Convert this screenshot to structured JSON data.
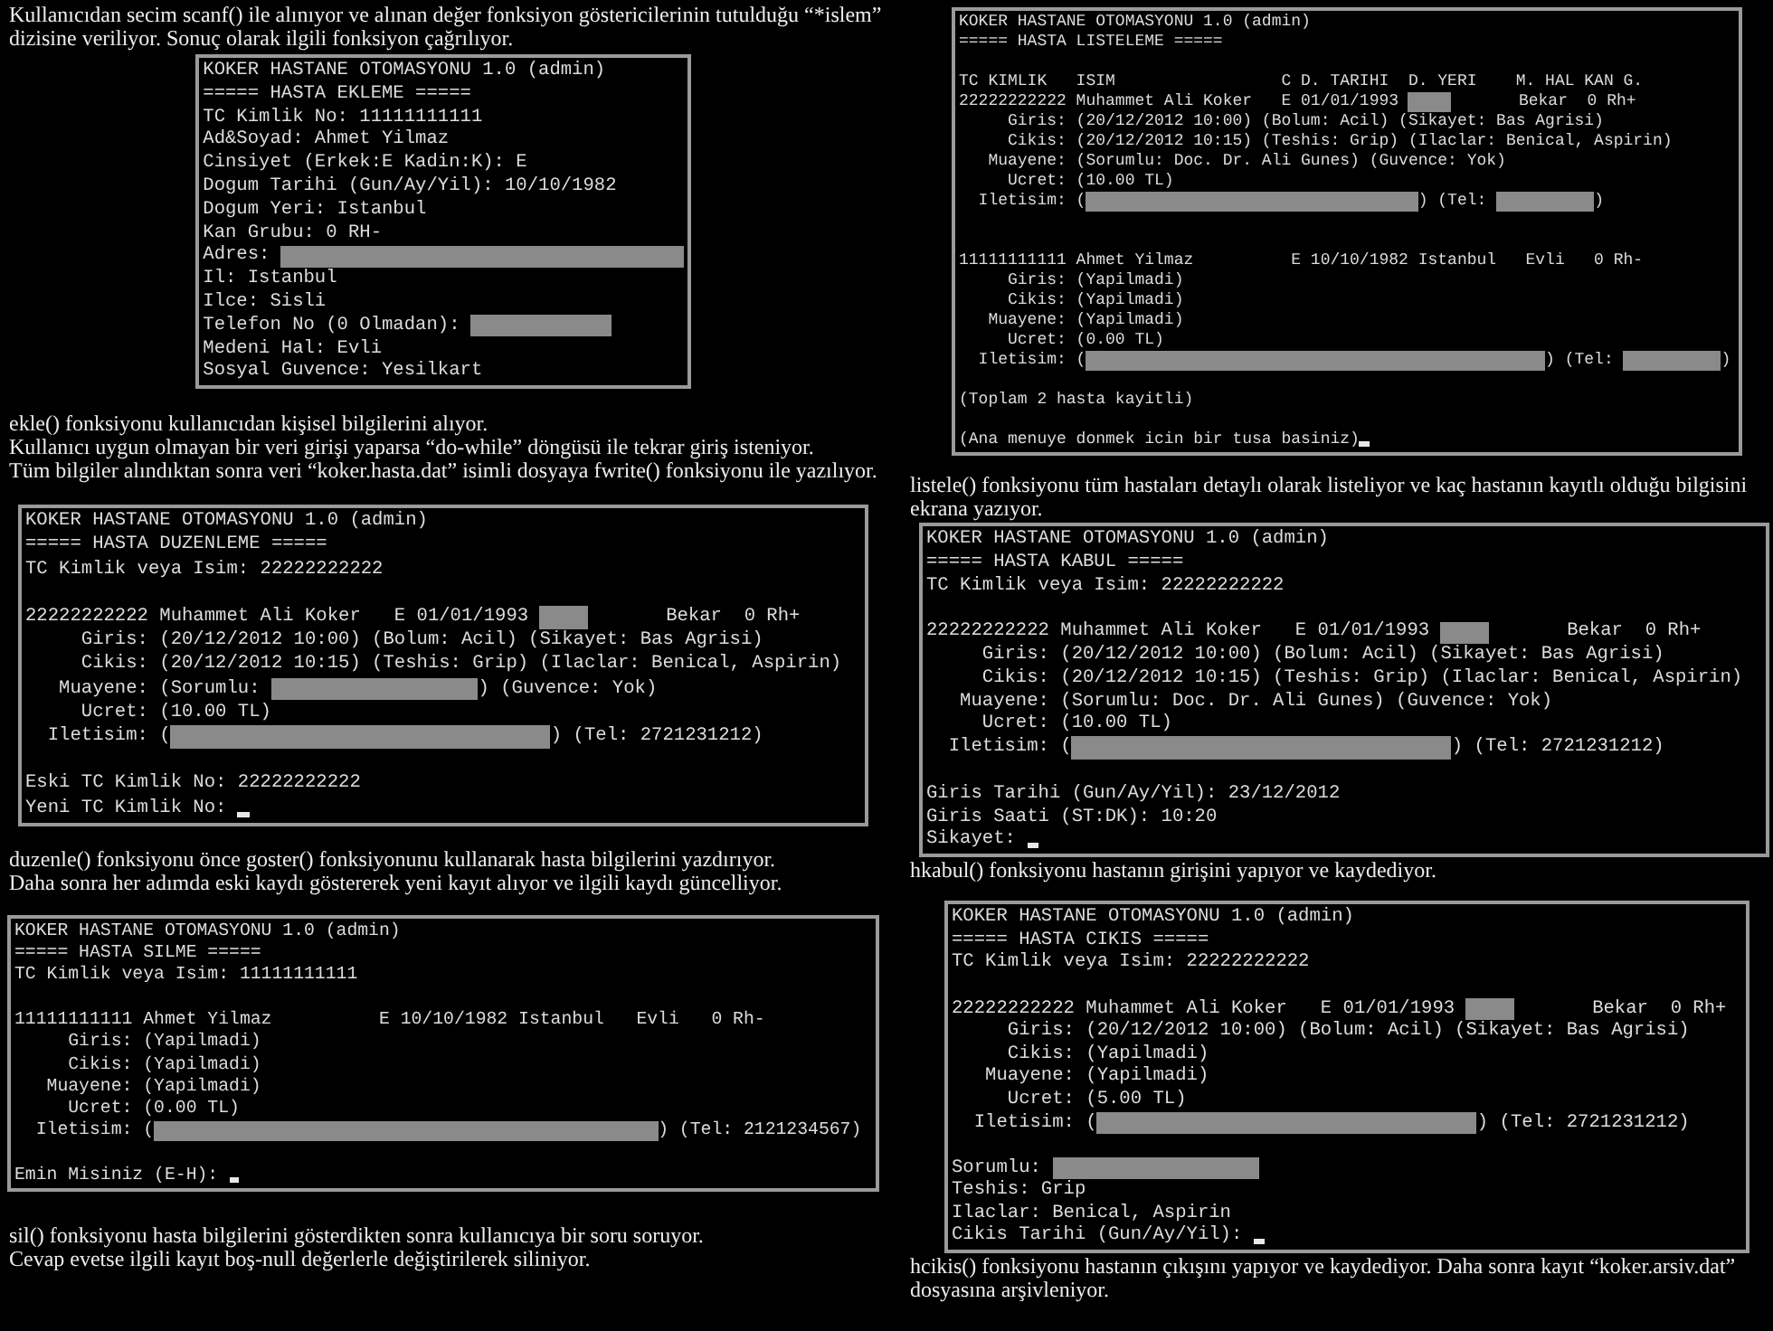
{
  "columns": [
    {
      "blocks": [
        {
          "kind": "caption",
          "lines": [
            "Kullanıcıdan secim scanf() ile alınıyor ve alınan değer fonksiyon göstericilerinin tutulduğu “*islem”",
            "dizisine veriliyor. Sonuç olarak ilgili fonksiyon çağrılıyor."
          ]
        },
        {
          "kind": "terminal",
          "lines": [
            {
              "parts": [
                "KOKER HASTANE OTOMASYONU 1.0 (admin)"
              ]
            },
            {
              "parts": [
                "===== HASTA EKLEME ====="
              ]
            },
            {
              "parts": [
                "TC Kimlik No: 11111111111"
              ]
            },
            {
              "parts": [
                "Ad&Soyad: Ahmet Yilmaz"
              ]
            },
            {
              "parts": [
                "Cinsiyet (Erkek:E Kadin:K): E"
              ]
            },
            {
              "parts": [
                "Dogum Tarihi (Gun/Ay/Yil): 10/10/1982"
              ]
            },
            {
              "parts": [
                "Dogum Yeri: Istanbul"
              ]
            },
            {
              "parts": [
                "Kan Grubu: 0 RH-"
              ]
            },
            {
              "parts": [
                "Adres: ",
                {
                  "kind": "longer_redaction"
                }
              ]
            },
            {
              "parts": [
                "Il: Istanbul"
              ]
            },
            {
              "parts": [
                "Ilce: Sisli"
              ]
            },
            {
              "parts": [
                "Telefon No (0 Olmadan): ",
                {
                  "kind": "medium_redaction"
                }
              ]
            },
            {
              "parts": [
                "Medeni Hal: Evli"
              ]
            },
            {
              "parts": [
                "Sosyal Guvence: Yesilkart"
              ]
            }
          ]
        },
        {
          "kind": "caption",
          "lines": [
            "ekle() fonksiyonu kullanıcıdan kişisel bilgilerini alıyor.",
            "Kullanıcı uygun olmayan bir veri girişi yaparsa “do-while” döngüsü ile tekrar giriş isteniyor.",
            "Tüm bilgiler alındıktan sonra veri “koker.hasta.dat” isimli dosyaya fwrite() fonksiyonu ile yazılıyor."
          ]
        },
        {
          "kind": "terminal",
          "cursor": true,
          "lines": [
            {
              "parts": [
                "KOKER HASTANE OTOMASYONU 1.0 (admin)"
              ]
            },
            {
              "parts": [
                "===== HASTA DUZENLEME ====="
              ]
            },
            {
              "parts": [
                "TC Kimlik veya Isim: 22222222222"
              ]
            },
            {
              "kind": "blank"
            },
            {
              "parts": [
                "22222222222 Muhammet Ali Koker   E 01/01/1993 ",
                {
                  "kind": "short_redaction"
                },
                "       Bekar  0 Rh+"
              ]
            },
            {
              "parts": [
                "     Giris: (20/12/2012 10:00) (Bolum: Acil) (Sikayet: Bas Agrisi)"
              ]
            },
            {
              "parts": [
                "     Cikis: (20/12/2012 10:15) (Teshis: Grip) (Ilaclar: Benical, Aspirin)"
              ]
            },
            {
              "parts": [
                "   Muayene: (Sorumlu: ",
                {
                  "kind": "wide_redaction"
                },
                ") (Guvence: Yok)"
              ]
            },
            {
              "parts": [
                "     Ucret: (10.00 TL)"
              ]
            },
            {
              "parts": [
                "  Iletisim: (",
                {
                  "kind": "long_redaction"
                },
                ") (Tel: 2721231212)"
              ]
            },
            {
              "kind": "blank"
            },
            {
              "parts": [
                "Eski TC Kimlik No: 22222222222"
              ]
            },
            {
              "parts": [
                "Yeni TC Kimlik No: "
              ]
            }
          ]
        },
        {
          "kind": "caption",
          "lines": [
            "duzenle() fonksiyonu önce goster() fonksiyonunu kullanarak hasta bilgilerini yazdırıyor.",
            "Daha sonra her adımda eski kaydı göstererek yeni kayıt alıyor ve ilgili kaydı güncelliyor."
          ]
        },
        {
          "kind": "terminal",
          "cursor": true,
          "lines": [
            {
              "parts": [
                "KOKER HASTANE OTOMASYONU 1.0 (admin)"
              ]
            },
            {
              "parts": [
                "===== HASTA SILME ====="
              ]
            },
            {
              "parts": [
                "TC Kimlik veya Isim: 11111111111"
              ]
            },
            {
              "kind": "blank"
            },
            {
              "parts": [
                "11111111111 Ahmet Yilmaz          E 10/10/1982 Istanbul   Evli   0 Rh-"
              ]
            },
            {
              "parts": [
                "     Giris: (Yapilmadi)"
              ]
            },
            {
              "parts": [
                "     Cikis: (Yapilmadi)"
              ]
            },
            {
              "parts": [
                "   Muayene: (Yapilmadi)"
              ]
            },
            {
              "parts": [
                "     Ucret: (0.00 TL)"
              ]
            },
            {
              "parts": [
                "  Iletisim: (",
                {
                  "kind": "longest_redaction"
                },
                ") (Tel: 2121234567)"
              ]
            },
            {
              "kind": "blank"
            },
            {
              "parts": [
                "Emin Misiniz (E-H): "
              ]
            }
          ]
        },
        {
          "kind": "caption",
          "lines": [
            "sil() fonksiyonu hasta bilgilerini gösterdikten sonra  kullanıcıya bir soru soruyor.",
            "Cevap evetse ilgili kayıt boş-null değerlerle değiştirilerek siliniyor."
          ]
        }
      ]
    },
    {
      "blocks": [
        {
          "kind": "terminal",
          "cursor": true,
          "lines": [
            {
              "parts": [
                "KOKER HASTANE OTOMASYONU 1.0 (admin)"
              ]
            },
            {
              "parts": [
                "===== HASTA LISTELEME ====="
              ]
            },
            {
              "kind": "blank"
            },
            {
              "parts": [
                "TC KIMLIK   ISIM                 C D. TARIHI  D. YERI    M. HAL KAN G."
              ]
            },
            {
              "parts": [
                "22222222222 Muhammet Ali Koker   E 01/01/1993 ",
                {
                  "kind": "short_redaction"
                },
                "       Bekar  0 Rh+"
              ]
            },
            {
              "parts": [
                "     Giris: (20/12/2012 10:00) (Bolum: Acil) (Sikayet: Bas Agrisi)"
              ]
            },
            {
              "parts": [
                "     Cikis: (20/12/2012 10:15) (Teshis: Grip) (Ilaclar: Benical, Aspirin)"
              ]
            },
            {
              "parts": [
                "   Muayene: (Sorumlu: Doc. Dr. Ali Gunes) (Guvence: Yok)"
              ]
            },
            {
              "parts": [
                "     Ucret: (10.00 TL)"
              ]
            },
            {
              "parts": [
                "  Iletisim: (",
                {
                  "kind": "long_redaction"
                },
                ") (Tel: ",
                {
                  "kind": "phone_redaction"
                },
                ")"
              ]
            },
            {
              "kind": "blank"
            },
            {
              "kind": "blank"
            },
            {
              "parts": [
                "11111111111 Ahmet Yilmaz          E 10/10/1982 Istanbul   Evli   0 Rh-"
              ]
            },
            {
              "parts": [
                "     Giris: (Yapilmadi)"
              ]
            },
            {
              "parts": [
                "     Cikis: (Yapilmadi)"
              ]
            },
            {
              "parts": [
                "   Muayene: (Yapilmadi)"
              ]
            },
            {
              "parts": [
                "     Ucret: (0.00 TL)"
              ]
            },
            {
              "parts": [
                "  Iletisim: (",
                {
                  "kind": "longest_redaction"
                },
                ") (Tel: ",
                {
                  "kind": "phone_redaction"
                },
                ")"
              ]
            },
            {
              "kind": "blank"
            },
            {
              "parts": [
                "(Toplam 2 hasta kayitli)"
              ]
            },
            {
              "kind": "blank"
            },
            {
              "parts": [
                "(Ana menuye donmek icin bir tusa basiniz)"
              ]
            }
          ]
        },
        {
          "kind": "caption",
          "lines": [
            "listele() fonksiyonu tüm hastaları detaylı olarak listeliyor ve kaç hastanın kayıtlı olduğu bilgisini",
            "ekrana yazıyor."
          ]
        },
        {
          "kind": "terminal",
          "cursor": true,
          "lines": [
            {
              "parts": [
                "KOKER HASTANE OTOMASYONU 1.0 (admin)"
              ]
            },
            {
              "parts": [
                "===== HASTA KABUL ====="
              ]
            },
            {
              "parts": [
                "TC Kimlik veya Isim: 22222222222"
              ]
            },
            {
              "kind": "blank"
            },
            {
              "parts": [
                "22222222222 Muhammet Ali Koker   E 01/01/1993 ",
                {
                  "kind": "short_redaction"
                },
                "       Bekar  0 Rh+"
              ]
            },
            {
              "parts": [
                "     Giris: (20/12/2012 10:00) (Bolum: Acil) (Sikayet: Bas Agrisi)"
              ]
            },
            {
              "parts": [
                "     Cikis: (20/12/2012 10:15) (Teshis: Grip) (Ilaclar: Benical, Aspirin)"
              ]
            },
            {
              "parts": [
                "   Muayene: (Sorumlu: Doc. Dr. Ali Gunes) (Guvence: Yok)"
              ]
            },
            {
              "parts": [
                "     Ucret: (10.00 TL)"
              ]
            },
            {
              "parts": [
                "  Iletisim: (",
                {
                  "kind": "long_redaction"
                },
                ") (Tel: 2721231212)"
              ]
            },
            {
              "kind": "blank"
            },
            {
              "parts": [
                "Giris Tarihi (Gun/Ay/Yil): 23/12/2012"
              ]
            },
            {
              "parts": [
                "Giris Saati (ST:DK): 10:20"
              ]
            },
            {
              "parts": [
                "Sikayet: "
              ]
            }
          ]
        },
        {
          "kind": "caption",
          "lines": [
            "hkabul() fonksiyonu hastanın girişini yapıyor ve kaydediyor."
          ]
        },
        {
          "kind": "terminal",
          "cursor": true,
          "lines": [
            {
              "parts": [
                "KOKER HASTANE OTOMASYONU 1.0 (admin)"
              ]
            },
            {
              "parts": [
                "===== HASTA CIKIS ====="
              ]
            },
            {
              "parts": [
                "TC Kimlik veya Isim: 22222222222"
              ]
            },
            {
              "kind": "blank"
            },
            {
              "parts": [
                "22222222222 Muhammet Ali Koker   E 01/01/1993 ",
                {
                  "kind": "short_redaction"
                },
                "       Bekar  0 Rh+"
              ]
            },
            {
              "parts": [
                "     Giris: (20/12/2012 10:00) (Bolum: Acil) (Sikayet: Bas Agrisi)"
              ]
            },
            {
              "parts": [
                "     Cikis: (Yapilmadi)"
              ]
            },
            {
              "parts": [
                "   Muayene: (Yapilmadi)"
              ]
            },
            {
              "parts": [
                "     Ucret: (5.00 TL)"
              ]
            },
            {
              "parts": [
                "  Iletisim: (",
                {
                  "kind": "long_redaction"
                },
                ") (Tel: 2721231212)"
              ]
            },
            {
              "kind": "blank"
            },
            {
              "parts": [
                "Sorumlu: ",
                {
                  "kind": "wide_redaction"
                }
              ]
            },
            {
              "parts": [
                "Teshis: Grip"
              ]
            },
            {
              "parts": [
                "Ilaclar: Benical, Aspirin"
              ]
            },
            {
              "parts": [
                "Cikis Tarihi (Gun/Ay/Yil): "
              ]
            }
          ]
        },
        {
          "kind": "caption",
          "lines": [
            "hcikis() fonksiyonu hastanın çıkışını yapıyor ve kaydediyor. Daha sonra kayıt “koker.arsiv.dat”",
            "dosyasına arşivleniyor."
          ]
        }
      ]
    }
  ]
}
